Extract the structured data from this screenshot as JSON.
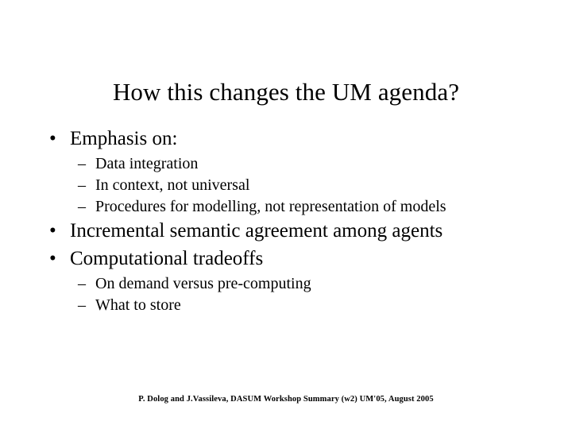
{
  "slide": {
    "title": "How this changes the UM agenda?",
    "background_color": "#ffffff",
    "text_color": "#000000",
    "bullet_marker": "•",
    "dash_marker": "–",
    "content": [
      {
        "level": 1,
        "text": "Emphasis on:"
      },
      {
        "level": 2,
        "text": "Data integration"
      },
      {
        "level": 2,
        "text": "In context, not universal"
      },
      {
        "level": 2,
        "text": "Procedures for modelling, not representation of models"
      },
      {
        "level": 1,
        "text": "Incremental semantic agreement among agents"
      },
      {
        "level": 1,
        "text": "Computational tradeoffs"
      },
      {
        "level": 2,
        "text": "On demand versus pre-computing"
      },
      {
        "level": 2,
        "text": "What to store"
      }
    ],
    "footer": "P. Dolog and J.Vassileva, DASUM Workshop Summary (w2) UM'05, August 2005"
  }
}
